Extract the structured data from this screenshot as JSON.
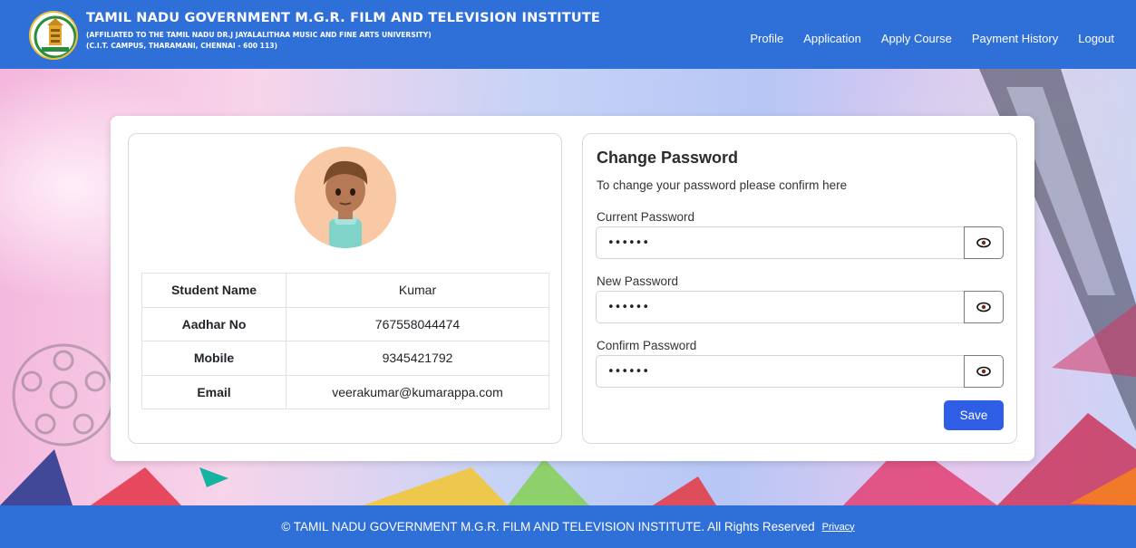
{
  "header": {
    "title": "TAMIL NADU GOVERNMENT M.G.R. FILM AND TELEVISION INSTITUTE",
    "subtitle1": "(AFFILIATED TO THE TAMIL NADU DR.J JAYALALITHAA MUSIC AND FINE ARTS UNIVERSITY)",
    "subtitle2": "(C.I.T. CAMPUS, THARAMANI, CHENNAI - 600 113)",
    "nav": [
      "Profile",
      "Application",
      "Apply Course",
      "Payment History",
      "Logout"
    ]
  },
  "profile": {
    "rows": [
      {
        "label": "Student Name",
        "value": "Kumar"
      },
      {
        "label": "Aadhar No",
        "value": "767558044474"
      },
      {
        "label": "Mobile",
        "value": "9345421792"
      },
      {
        "label": "Email",
        "value": "veerakumar@kumarappa.com"
      }
    ]
  },
  "change_password": {
    "title": "Change Password",
    "subtitle": "To change your password please confirm here",
    "current_label": "Current Password",
    "current_value": "••••••",
    "new_label": "New Password",
    "new_value": "••••••",
    "confirm_label": "Confirm Password",
    "confirm_value": "••••••",
    "save_label": "Save",
    "icon": "eye-icon"
  },
  "footer": {
    "text": "© TAMIL NADU GOVERNMENT M.G.R. FILM AND TELEVISION INSTITUTE. All Rights Reserved",
    "privacy": "Privacy"
  },
  "colors": {
    "header_bg": "#2f6fd8",
    "save_button": "#2e5de6"
  }
}
